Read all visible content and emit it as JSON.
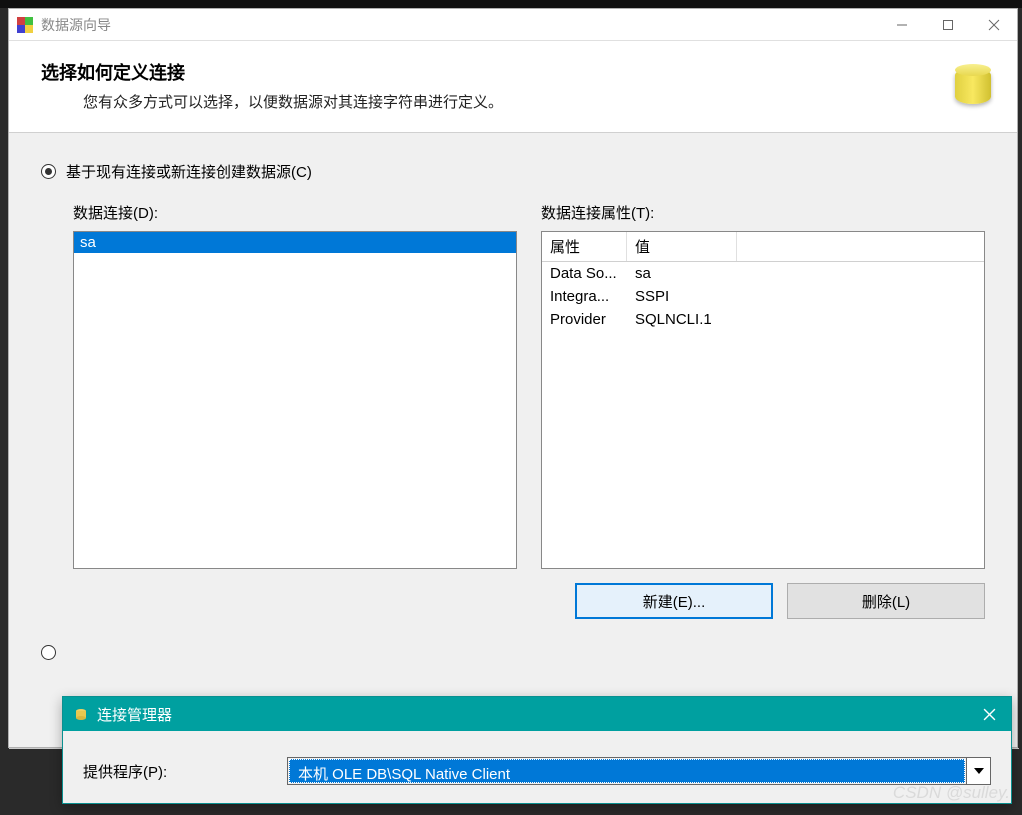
{
  "main_window": {
    "title": "数据源向导",
    "header_title": "选择如何定义连接",
    "header_subtitle": "您有众多方式可以选择，以便数据源对其连接字符串进行定义。",
    "radio1_label": "基于现有连接或新连接创建数据源(C)",
    "connections_label": "数据连接(D):",
    "properties_label": "数据连接属性(T):",
    "connections": [
      {
        "name": "sa",
        "selected": true
      }
    ],
    "prop_header_attr": "属性",
    "prop_header_val": "值",
    "properties": [
      {
        "attr": "Data So...",
        "val": "sa"
      },
      {
        "attr": "Integra...",
        "val": "SSPI"
      },
      {
        "attr": "Provider",
        "val": "SQLNCLI.1"
      }
    ],
    "btn_new": "新建(E)...",
    "btn_delete": "删除(L)"
  },
  "sub_window": {
    "title": "连接管理器",
    "provider_label": "提供程序(P):",
    "provider_value": "本机 OLE DB\\SQL Native Client"
  },
  "watermark": "CSDN @sulley."
}
